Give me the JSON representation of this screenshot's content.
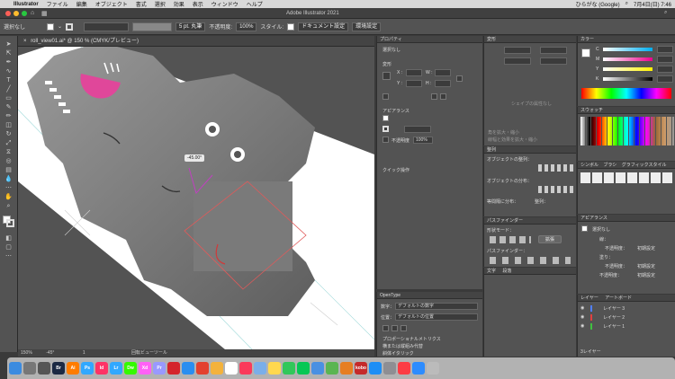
{
  "menubar": {
    "apple": "",
    "app": "Illustrator",
    "items": [
      "ファイル",
      "編集",
      "オブジェクト",
      "書式",
      "選択",
      "効果",
      "表示",
      "ウィンドウ",
      "ヘルプ"
    ],
    "ime": "ひらがな (Google)",
    "clock": "7月4日(日)  7:46"
  },
  "window": {
    "title": "Adobe Illustrator 2021"
  },
  "control": {
    "selection": "選択なし",
    "stroke_size": "5 pt. 丸筆",
    "opacity_label": "不透明度:",
    "opacity": "100%",
    "style_label": "スタイル:",
    "doc_settings": "ドキュメント設定",
    "prefs": "環境設定"
  },
  "tab": {
    "label": "roll_view01.ai* @ 150 % (CMYK/プレビュー)"
  },
  "canvas": {
    "angle_tip": "-45.00°"
  },
  "status": {
    "zoom": "150%",
    "angle": "-45°",
    "page": "1",
    "mode": "回転ビューツール"
  },
  "properties": {
    "title": "プロパティ",
    "no_sel": "選択なし",
    "transform": "変形",
    "x": "X :",
    "y": "Y :",
    "w": "W :",
    "h": "H :",
    "appearance": "アピアランス",
    "opacity_label": "不透明度",
    "opacity_val": "100%",
    "quick": "クイック操作"
  },
  "transparency": {
    "tab": "変形",
    "shape_msg": "シェイプの属性なし",
    "cb1": "角を拡大・縮小",
    "cb2": "線幅と効果を拡大・縮小"
  },
  "align": {
    "tab": "整列",
    "objects": "オブジェクトの整列：",
    "dist": "オブジェクトの分布：",
    "spacing": "等間隔に分布：",
    "target": "整列："
  },
  "pathfinder": {
    "tab": "パスファインダー",
    "shape_modes": "形状モード：",
    "expand": "拡張",
    "pathfinder": "パスファインダー："
  },
  "char": {
    "tab1": "文字",
    "tab2": "段落"
  },
  "opentype": {
    "tab": "OpenType",
    "numbers_label": "数字：",
    "numbers": "デフォルトの数字",
    "pos_label": "位置：",
    "pos": "デフォルトの位置",
    "opt1": "プロポーショナルメトリクス",
    "opt2": "横または縦組み代替",
    "opt3": "斜体イタリック"
  },
  "color": {
    "tab": "カラー",
    "c": "C",
    "m": "M",
    "y": "Y",
    "k": "K",
    "swatch_tab": "スウォッチ"
  },
  "symbols": {
    "tab1": "シンボル",
    "tab2": "ブラシ",
    "tab3": "グラフィックスタイル"
  },
  "appearance": {
    "tab": "アピアランス",
    "no_sel": "選択なし",
    "stroke": "線：",
    "fill": "塗り：",
    "opacity": "不透明度：",
    "default": "初期設定"
  },
  "layers": {
    "tab1": "レイヤー",
    "tab2": "アートボード",
    "items": [
      "レイヤー 3",
      "レイヤー 2",
      "レイヤー 1"
    ],
    "count": "3レイヤー"
  },
  "dock": [
    {
      "name": "finder",
      "label": "",
      "color": "#3b8be0"
    },
    {
      "name": "launchpad",
      "label": "",
      "color": "#777"
    },
    {
      "name": "system",
      "label": "",
      "color": "#555"
    },
    {
      "name": "bridge",
      "label": "Br",
      "color": "#1c2a44"
    },
    {
      "name": "illustrator",
      "label": "Ai",
      "color": "#ff7c00"
    },
    {
      "name": "photoshop",
      "label": "Ps",
      "color": "#31a8ff"
    },
    {
      "name": "indesign",
      "label": "Id",
      "color": "#ff3366"
    },
    {
      "name": "lightroom",
      "label": "Lr",
      "color": "#31a8ff"
    },
    {
      "name": "dreamweaver",
      "label": "Dw",
      "color": "#35fa00"
    },
    {
      "name": "xd",
      "label": "Xd",
      "color": "#ff61f6"
    },
    {
      "name": "premiere",
      "label": "Pr",
      "color": "#9999ff"
    },
    {
      "name": "acrobat",
      "label": "",
      "color": "#d4252b"
    },
    {
      "name": "safari",
      "label": "",
      "color": "#2a8ef0"
    },
    {
      "name": "chrome",
      "label": "",
      "color": "#e3412f"
    },
    {
      "name": "photos",
      "label": "",
      "color": "#f3b23c"
    },
    {
      "name": "calendar",
      "label": "",
      "color": "#fff"
    },
    {
      "name": "music",
      "label": "",
      "color": "#fa3a5a"
    },
    {
      "name": "preview",
      "label": "",
      "color": "#7aaee9"
    },
    {
      "name": "notes",
      "label": "",
      "color": "#ffd84e"
    },
    {
      "name": "messages",
      "label": "",
      "color": "#31c75a"
    },
    {
      "name": "line",
      "label": "",
      "color": "#06c755"
    },
    {
      "name": "mail",
      "label": "",
      "color": "#4a90e2"
    },
    {
      "name": "maps",
      "label": "",
      "color": "#5ab552"
    },
    {
      "name": "book",
      "label": "",
      "color": "#e67e22"
    },
    {
      "name": "kobo",
      "label": "kobo",
      "color": "#c52a2a"
    },
    {
      "name": "appstore",
      "label": "",
      "color": "#1d8ef5"
    },
    {
      "name": "settings",
      "label": "",
      "color": "#8e8e93"
    },
    {
      "name": "music2",
      "label": "",
      "color": "#fc3c44"
    },
    {
      "name": "zoom",
      "label": "",
      "color": "#2d8cff"
    },
    {
      "name": "trash",
      "label": "",
      "color": "#bbb"
    }
  ]
}
